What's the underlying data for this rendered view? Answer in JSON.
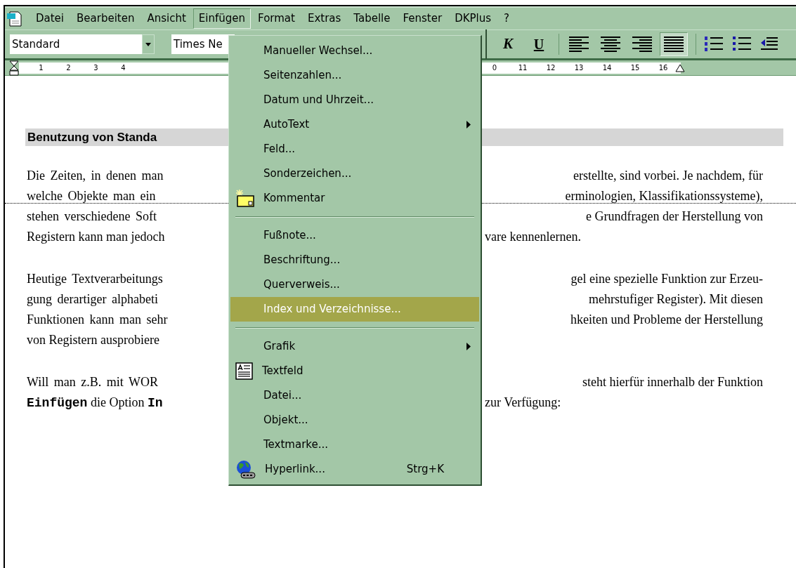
{
  "menu_bar": [
    {
      "label": "Datei",
      "selected": false
    },
    {
      "label": "Bearbeiten",
      "selected": false
    },
    {
      "label": "Ansicht",
      "selected": false
    },
    {
      "label": "Einfügen",
      "selected": true
    },
    {
      "label": "Format",
      "selected": false
    },
    {
      "label": "Extras",
      "selected": false
    },
    {
      "label": "Tabelle",
      "selected": false
    },
    {
      "label": "Fenster",
      "selected": false
    },
    {
      "label": "DKPlus",
      "selected": false
    },
    {
      "label": "?",
      "selected": false
    }
  ],
  "toolbar": {
    "style_box": "Standard",
    "font_box": "Times Ne",
    "text_buttons": [
      {
        "label": "K",
        "kind": "italic"
      },
      {
        "label": "U",
        "kind": "underline"
      }
    ],
    "alignment": [
      {
        "selected": false
      },
      {
        "selected": false
      },
      {
        "selected": false
      },
      {
        "selected": true
      }
    ]
  },
  "ruler": {
    "left_numbers": [
      "1",
      "2",
      "3",
      "4"
    ],
    "right_numbers": [
      "0",
      "11",
      "12",
      "13",
      "14",
      "15",
      "16"
    ]
  },
  "document": {
    "heading": "Benutzung von Standa",
    "paragraphs": [
      [
        {
          "left": "Die Zeiten, in denen man",
          "right": "erstellte, sind vorbei. Je nachdem, für"
        },
        {
          "left": "welche Objekte man ein",
          "right": "erminologien, Klassifikationssysteme),"
        },
        {
          "left": "stehen verschiedene Soft",
          "right": "e Grundfragen der Herstellung von"
        },
        {
          "left": "Registern kann man jedoch",
          "right": "vare kennenlernen."
        }
      ],
      [
        {
          "left": "Heutige Textverarbeitungs",
          "right": "gel eine spezielle Funktion zur Erzeu-"
        },
        {
          "left": "gung derartiger alphabeti",
          "right": "mehrstufiger Register). Mit diesen"
        },
        {
          "left": "Funktionen kann man sehr",
          "right": "hkeiten und Probleme der Herstellung"
        },
        {
          "left": "von Registern ausprobiere"
        }
      ],
      [
        {
          "left": "Will man z.B. mit WOR",
          "right": "steht hierfür innerhalb der Funktion"
        },
        {
          "left": "**Einfügen** die Option **In**",
          "right": "zur Verfügung:"
        }
      ]
    ]
  },
  "insert_menu": [
    {
      "label": "Manueller Wechsel...",
      "kind": "item",
      "selected": false
    },
    {
      "label": "Seitenzahlen...",
      "kind": "item",
      "selected": false
    },
    {
      "label": "Datum und Uhrzeit...",
      "kind": "item",
      "selected": false
    },
    {
      "label": "AutoText",
      "kind": "submenu",
      "selected": false
    },
    {
      "label": "Feld...",
      "kind": "item",
      "selected": false
    },
    {
      "label": "Sonderzeichen...",
      "kind": "item",
      "selected": false
    },
    {
      "label": "Kommentar",
      "kind": "comment",
      "selected": false
    },
    {
      "kind": "separator"
    },
    {
      "label": "Fußnote...",
      "kind": "item",
      "selected": false
    },
    {
      "label": "Beschriftung...",
      "kind": "item",
      "selected": false
    },
    {
      "label": "Querverweis...",
      "kind": "item",
      "selected": false
    },
    {
      "label": "Index und Verzeichnisse...",
      "kind": "item",
      "selected": true
    },
    {
      "kind": "separator"
    },
    {
      "label": "Grafik",
      "kind": "submenu",
      "selected": false
    },
    {
      "label": "Textfeld",
      "kind": "textbox",
      "selected": false
    },
    {
      "label": "Datei...",
      "kind": "item",
      "selected": false
    },
    {
      "label": "Objekt...",
      "kind": "item",
      "selected": false
    },
    {
      "label": "Textmarke...",
      "kind": "item",
      "selected": false
    },
    {
      "label": "Hyperlink...",
      "kind": "hyperlink",
      "shortcut": "Strg+K",
      "selected": false
    }
  ]
}
